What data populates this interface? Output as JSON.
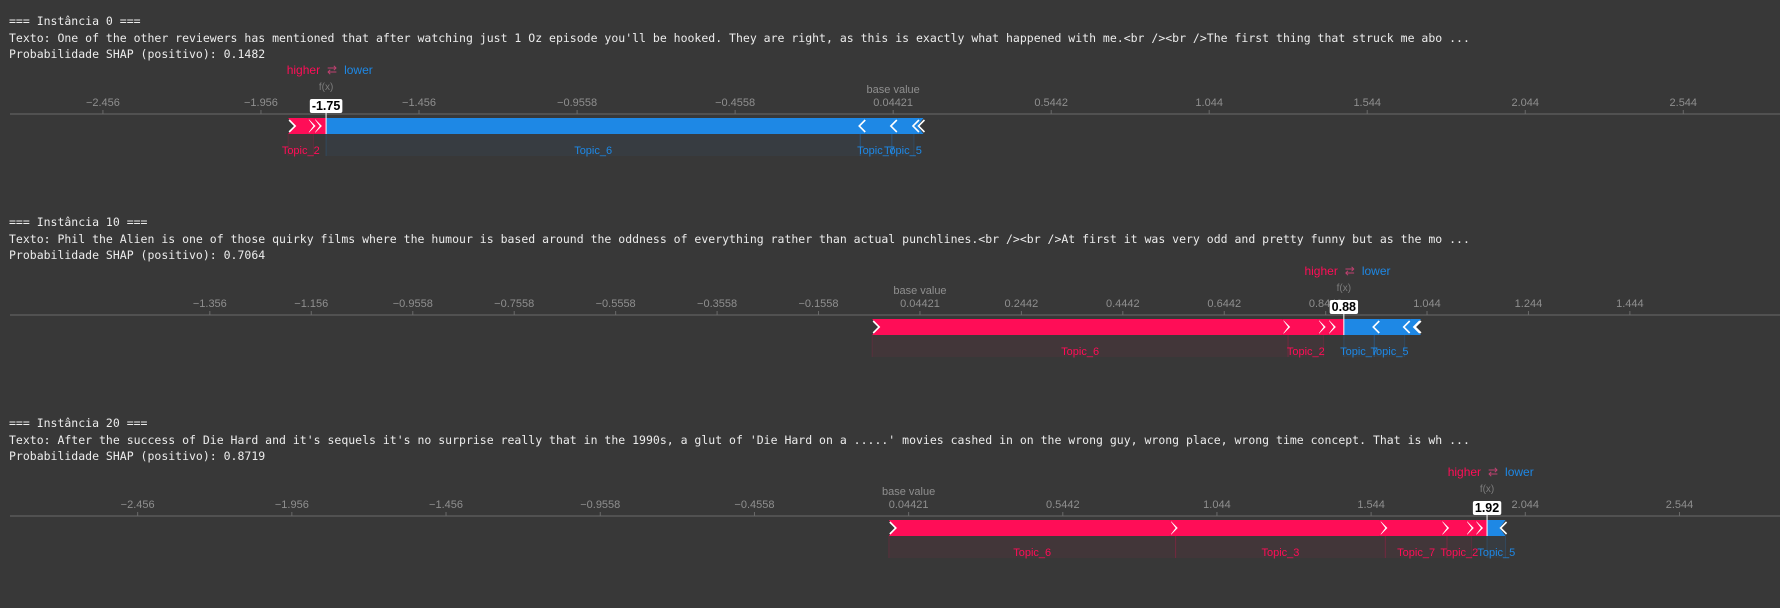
{
  "colors": {
    "positive": "#ff0d57",
    "negative": "#1e88e5",
    "background": "#383838",
    "text": "#ececec",
    "axis": "#8f8f8f"
  },
  "legend": {
    "higher": "higher",
    "lower": "lower",
    "arrows": "⇄"
  },
  "axis_texts": {
    "base_value": "base value",
    "fx": "f(x)"
  },
  "instances": [
    {
      "header": "=== Instância 0 ===",
      "texto": "Texto: One of the other reviewers has mentioned that after watching just 1 Oz episode you'll be hooked. They are right, as this is exactly what happened with me.<br /><br />The first thing that struck me abo ...",
      "prob": "Probabilidade SHAP (positivo): 0.1482"
    },
    {
      "header": "=== Instância 10 ===",
      "texto": "Texto: Phil the Alien is one of those quirky films where the humour is based around the oddness of everything rather than actual punchlines.<br /><br />At first it was very odd and pretty funny but as the mo ...",
      "prob": "Probabilidade SHAP (positivo): 0.7064"
    },
    {
      "header": "=== Instância 20 ===",
      "texto": "Texto: After the success of Die Hard and it's sequels it's no surprise really that in the 1990s, a glut of 'Die Hard on a .....' movies cashed in on the wrong guy, wrong place, wrong time concept. That is wh ...",
      "prob": "Probabilidade SHAP (positivo): 0.8719"
    }
  ],
  "chart_data": [
    {
      "type": "bar",
      "subtype": "shap_force_plot",
      "base_value": 0.04421,
      "output_value": -1.75,
      "output_label": "-1.75",
      "xlim": [
        -2.75,
        2.85
      ],
      "ticks": [
        -2.456,
        -1.956,
        -1.456,
        -0.9558,
        -0.4558,
        0.04421,
        0.5442,
        1.044,
        1.544,
        2.044,
        2.544
      ],
      "tick_labels": [
        "−2.456",
        "−1.956",
        "−1.456",
        "−0.9558",
        "−0.4558",
        "0.04421",
        "0.5442",
        "1.044",
        "1.544",
        "2.044",
        "2.544"
      ],
      "positive": [
        {
          "name": "Topic_2",
          "value": 0.08
        },
        {
          "name": "",
          "value": 0.02
        },
        {
          "name": "",
          "value": 0.02
        }
      ],
      "negative": [
        {
          "name": "Topic_6",
          "value": 1.69
        },
        {
          "name": "Topic_7",
          "value": 0.1
        },
        {
          "name": "Topic_5",
          "value": 0.07
        },
        {
          "name": "",
          "value": 0.03
        }
      ]
    },
    {
      "type": "bar",
      "subtype": "shap_force_plot",
      "base_value": 0.04421,
      "output_value": 0.88,
      "output_label": "0.88",
      "xlim": [
        -1.75,
        1.74
      ],
      "ticks": [
        -1.356,
        -1.156,
        -0.9558,
        -0.7558,
        -0.5558,
        -0.3558,
        -0.1558,
        0.04421,
        0.2442,
        0.4442,
        0.6442,
        0.8442,
        1.044,
        1.244,
        1.444
      ],
      "tick_labels": [
        "−1.356",
        "−1.156",
        "−0.9558",
        "−0.7558",
        "−0.5558",
        "−0.3558",
        "−0.1558",
        "0.04421",
        "0.2442",
        "0.4442",
        "0.6442",
        "0.8442",
        "1.044",
        "1.244",
        "1.444"
      ],
      "positive": [
        {
          "name": "Topic_2",
          "value": 0.07
        },
        {
          "name": "Topic_6",
          "value": 0.82
        },
        {
          "name": "",
          "value": 0.02
        },
        {
          "name": "",
          "value": 0.02
        }
      ],
      "negative": [
        {
          "name": "Topic_7",
          "value": 0.06
        },
        {
          "name": "Topic_5",
          "value": 0.06
        },
        {
          "name": "",
          "value": 0.02
        },
        {
          "name": "",
          "value": 0.01
        }
      ]
    },
    {
      "type": "bar",
      "subtype": "shap_force_plot",
      "base_value": 0.04421,
      "output_value": 1.92,
      "output_label": "1.92",
      "xlim": [
        -2.87,
        2.87
      ],
      "ticks": [
        -2.456,
        -1.956,
        -1.456,
        -0.9558,
        -0.4558,
        0.04421,
        0.5442,
        1.044,
        1.544,
        2.044,
        2.544
      ],
      "tick_labels": [
        "−2.456",
        "−1.956",
        "−1.456",
        "−0.9558",
        "−0.4558",
        "0.04421",
        "0.5442",
        "1.044",
        "1.544",
        "2.044",
        "2.544"
      ],
      "positive": [
        {
          "name": "Topic_6",
          "value": 0.93
        },
        {
          "name": "Topic_3",
          "value": 0.68
        },
        {
          "name": "Topic_7",
          "value": 0.2
        },
        {
          "name": "Topic_2",
          "value": 0.08
        },
        {
          "name": "",
          "value": 0.03
        },
        {
          "name": "",
          "value": 0.02
        }
      ],
      "negative": [
        {
          "name": "Topic_5",
          "value": 0.06
        }
      ]
    }
  ]
}
